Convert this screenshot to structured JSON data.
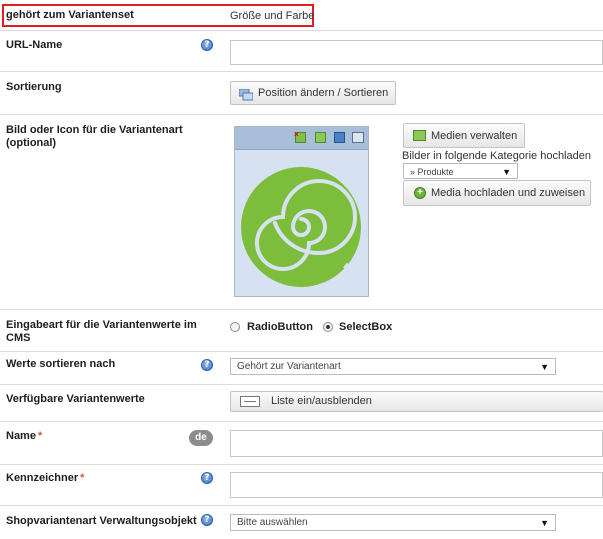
{
  "variantset": {
    "label": "gehört zum Variantenset",
    "value": "Größe und Farbe"
  },
  "url_name": {
    "label": "URL-Name",
    "help": "?",
    "value": ""
  },
  "sortierung": {
    "label": "Sortierung",
    "button": "Position ändern / Sortieren"
  },
  "bild": {
    "label": "Bild oder Icon für die Variantenart (optional)",
    "medien_button": "Medien verwalten",
    "kategorie_label": "Bilder in folgende Kategorie hochladen",
    "kategorie_value": "» Produkte",
    "upload_button": "Media hochladen und zuweisen"
  },
  "eingabeart": {
    "label": "Eingabeart für die Variantenwerte im CMS",
    "options": [
      "RadioButton",
      "SelectBox"
    ],
    "selected": "SelectBox"
  },
  "werte_sortieren": {
    "label": "Werte sortieren nach",
    "help": "?",
    "value": "Gehört zur Variantenart"
  },
  "verfuegbare": {
    "label": "Verfügbare Variantenwerte",
    "button": "Liste ein/ausblenden"
  },
  "name": {
    "label": "Name",
    "required": "*",
    "lang_badge": "de",
    "value": ""
  },
  "kennzeichner": {
    "label": "Kennzeichner",
    "required": "*",
    "help": "?",
    "value": ""
  },
  "verwaltungsobjekt": {
    "label": "Shopvariantenart Verwaltungsobjekt",
    "help": "?",
    "value": "Bitte auswählen"
  },
  "colors": {
    "highlight_border": "#e02020",
    "swirl": "#7cbd3c",
    "image_bg": "#d6e2f2",
    "toolbar": "#a9bfd9"
  }
}
